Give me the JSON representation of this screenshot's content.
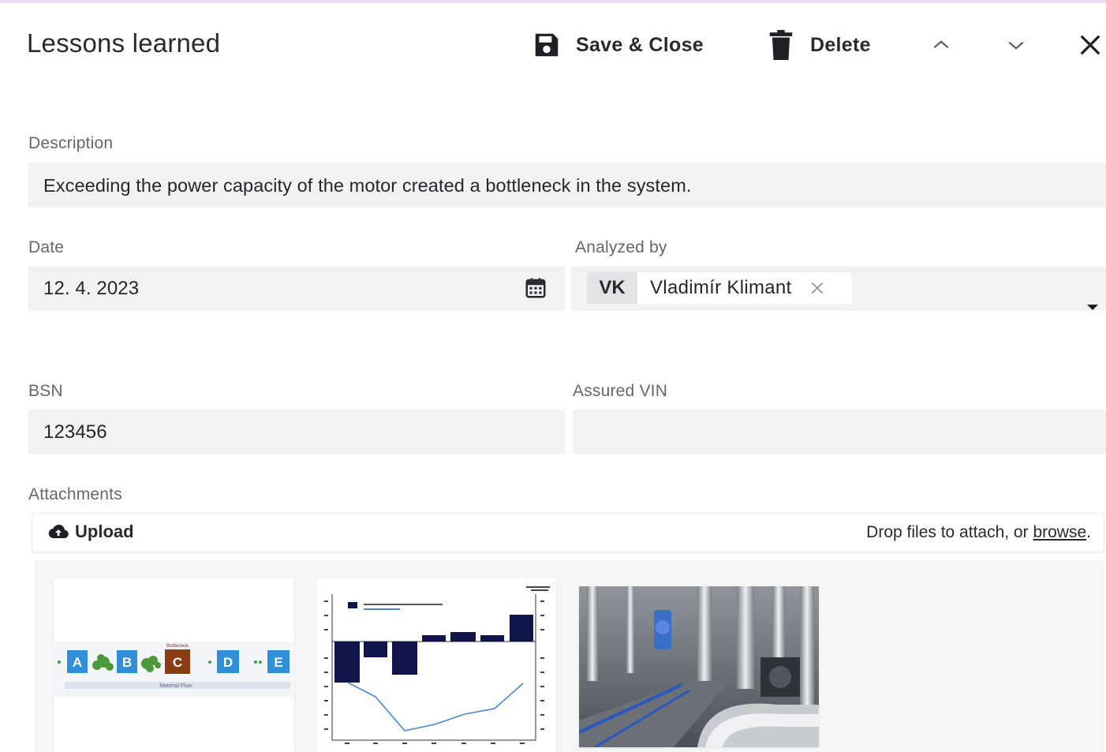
{
  "header": {
    "title": "Lessons learned",
    "save_label": "Save & Close",
    "delete_label": "Delete"
  },
  "icons": {
    "save": "floppy-disk-icon",
    "delete": "trash-icon",
    "up": "chevron-up-icon",
    "down": "chevron-down-icon",
    "close": "close-icon",
    "calendar": "calendar-icon",
    "upload": "cloud-upload-icon",
    "dropdown": "caret-down-icon"
  },
  "form": {
    "description": {
      "label": "Description",
      "value": "Exceeding the power capacity of the motor created a bottleneck in the system."
    },
    "date": {
      "label": "Date",
      "value": "12. 4. 2023"
    },
    "analyzed_by": {
      "label": "Analyzed by",
      "initials": "VK",
      "name": "Vladimír Klimant"
    },
    "bsn": {
      "label": "BSN",
      "value": "123456"
    },
    "assured_vin": {
      "label": "Assured VIN",
      "value": ""
    }
  },
  "attachments": {
    "label": "Attachments",
    "upload_label": "Upload",
    "drop_text": "Drop files to attach, or",
    "browse_label": "browse",
    "drop_suffix": ".",
    "items": [
      {
        "kind": "diagram",
        "labels": [
          "A",
          "B",
          "C",
          "D",
          "E"
        ],
        "caption": "Material Flow",
        "note": "Bottleneck"
      },
      {
        "kind": "chart"
      },
      {
        "kind": "photo"
      }
    ]
  },
  "colors": {
    "accent_bar": "#e7dcf4",
    "field_bg": "#f2f2f3",
    "diagram_blue": "#2f8fd8",
    "diagram_brown": "#8a3c12",
    "chart_navy": "#10144a",
    "chart_line": "#4a86d4"
  }
}
